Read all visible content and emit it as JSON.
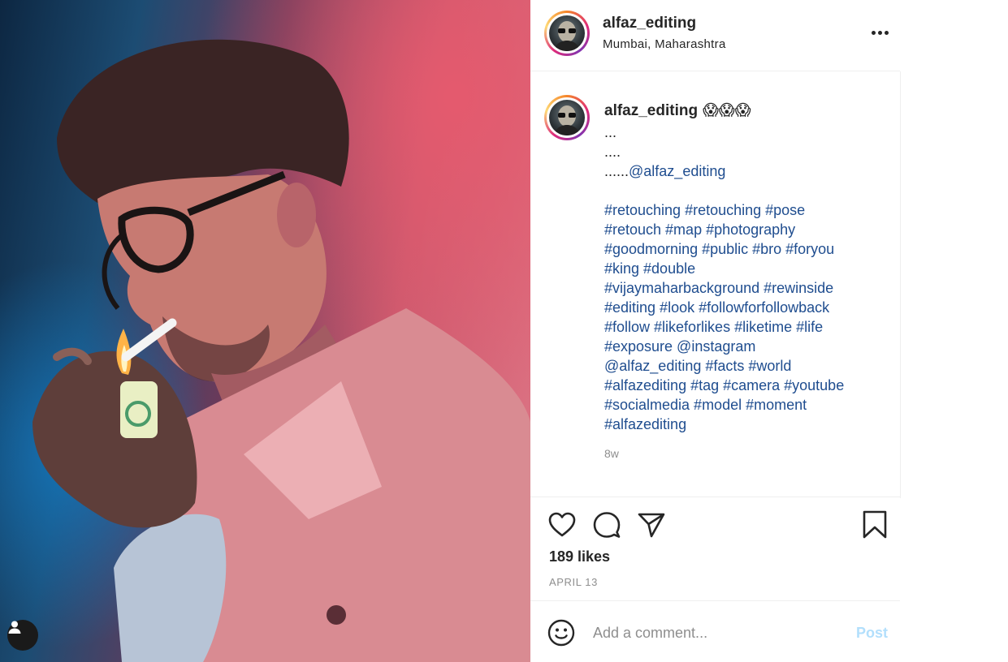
{
  "post": {
    "photo_alt": "",
    "author": {
      "username": "alfaz_editing",
      "location": "Mumbai, Maharashtra"
    },
    "caption": {
      "username": "alfaz_editing",
      "emoji": "😱😱😱",
      "lines": "...\n....\n......",
      "mention": "@alfaz_editing",
      "hashtags": "#retouching #retouching #pose\n#retouch #map #photography\n#goodmorning #public #bro #foryou\n#king #double\n#vijaymaharbackground #rewinside\n#editing #look #followforfollowback\n#follow #likeforlikes #liketime #life\n#exposure @instagram\n@alfaz_editing #facts #world\n#alfazediting #tag #camera #youtube\n#socialmedia #model #moment\n#alfazediting",
      "time_ago": "8w"
    },
    "likes": "189 likes",
    "date": "APRIL 13",
    "comment": {
      "placeholder": "Add a comment...",
      "post_label": "Post"
    }
  },
  "icons": {
    "more": "more-horizontal-icon",
    "like": "heart-icon",
    "comment": "comment-bubble-icon",
    "share": "paper-plane-icon",
    "save": "bookmark-icon",
    "emoji": "smiley-icon",
    "tagged": "user-icon"
  },
  "colors": {
    "text": "#262626",
    "muted": "#8e8e8e",
    "link": "#1f4d8f",
    "post_disabled": "#b2dffc"
  }
}
